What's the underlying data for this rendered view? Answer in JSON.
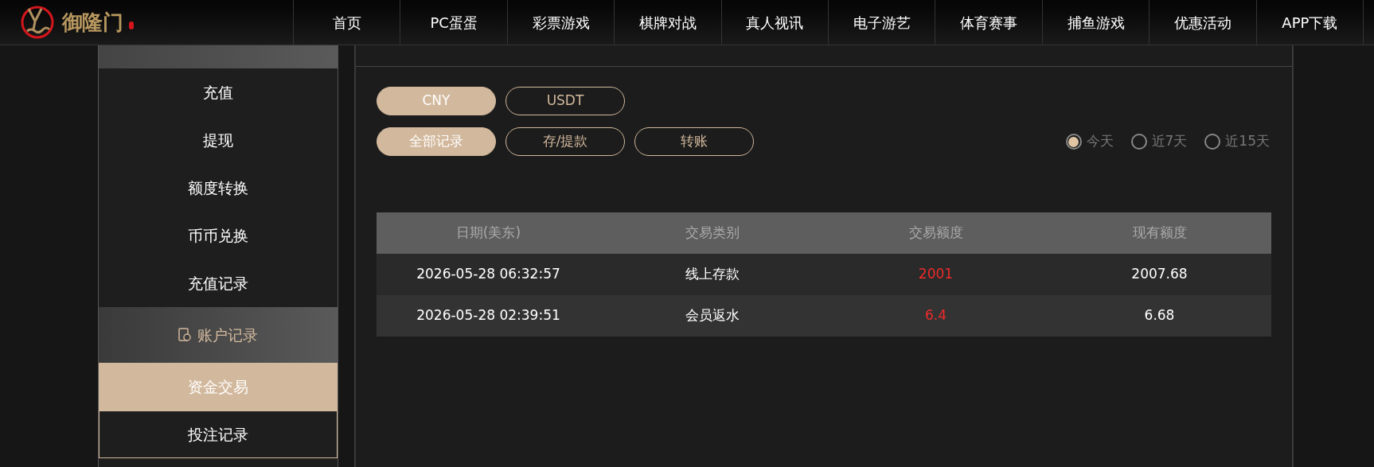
{
  "logo": {
    "name": "御隆门"
  },
  "nav": [
    {
      "label": "首页"
    },
    {
      "label": "PC蛋蛋"
    },
    {
      "label": "彩票游戏"
    },
    {
      "label": "棋牌对战"
    },
    {
      "label": "真人视讯"
    },
    {
      "label": "电子游艺"
    },
    {
      "label": "体育赛事"
    },
    {
      "label": "捕鱼游戏"
    },
    {
      "label": "优惠活动"
    },
    {
      "label": "APP下载"
    }
  ],
  "sidebar": [
    {
      "kind": "item",
      "label": "充值",
      "selected": false
    },
    {
      "kind": "item",
      "label": "提现",
      "selected": false
    },
    {
      "kind": "item",
      "label": "额度转换",
      "selected": false
    },
    {
      "kind": "item",
      "label": "币币兑换",
      "selected": false
    },
    {
      "kind": "item",
      "label": "充值记录",
      "selected": false
    },
    {
      "kind": "header",
      "label": "账户记录"
    },
    {
      "kind": "item",
      "label": "资金交易",
      "selected": true
    },
    {
      "kind": "item",
      "label": "投注记录",
      "selected": false
    }
  ],
  "currency_tabs": [
    {
      "label": "CNY",
      "selected": true
    },
    {
      "label": "USDT",
      "selected": false
    }
  ],
  "type_tabs": [
    {
      "label": "全部记录",
      "selected": true
    },
    {
      "label": "存/提款",
      "selected": false
    },
    {
      "label": "转账",
      "selected": false
    }
  ],
  "date_filter": [
    {
      "label": "今天",
      "selected": true
    },
    {
      "label": "近7天",
      "selected": false
    },
    {
      "label": "近15天",
      "selected": false
    }
  ],
  "table": {
    "columns": [
      "日期(美东)",
      "交易类别",
      "交易额度",
      "现有额度"
    ],
    "rows": [
      [
        "2026-05-28 06:32:57",
        "线上存款",
        "2001",
        "2007.68"
      ],
      [
        "2026-05-28 02:39:51",
        "会员返水",
        "6.4",
        "6.68"
      ]
    ]
  }
}
